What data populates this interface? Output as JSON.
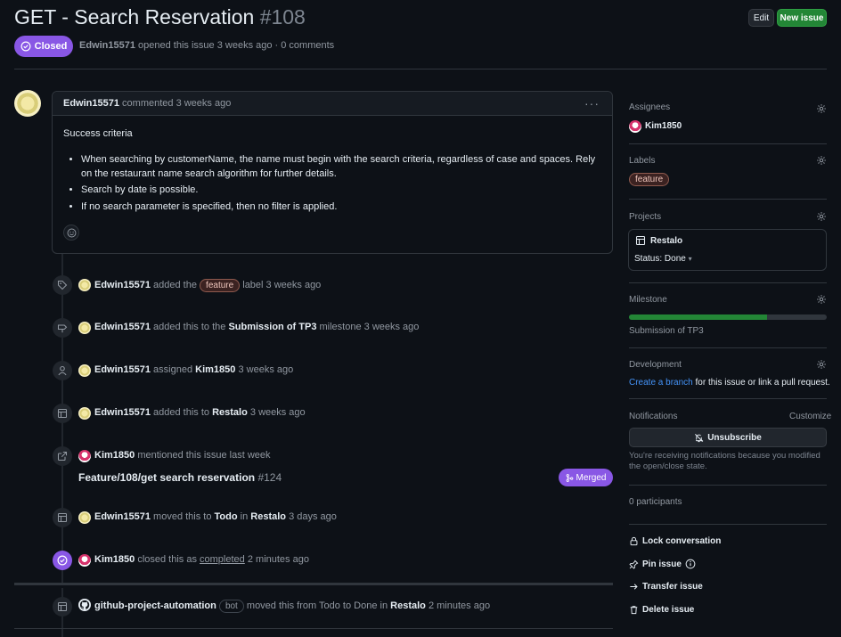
{
  "issue": {
    "title": "GET - Search Reservation",
    "number": "#108",
    "edit_label": "Edit",
    "new_issue_label": "New issue",
    "state": "Closed",
    "author": "Edwin15571",
    "meta_rest": " opened this issue 3 weeks ago · 0 comments"
  },
  "comment": {
    "author": "Edwin15571",
    "action": " commented 3 weeks ago",
    "heading": "Success criteria",
    "bullets": [
      "When searching by customerName, the name must begin with the search criteria, regardless of case and spaces. Rely on the restaurant name search algorithm for further details.",
      "Search by date is possible.",
      "If no search parameter is specified, then no filter is applied."
    ]
  },
  "timeline": {
    "e1": {
      "actor": "Edwin15571",
      "pre": " added the ",
      "label": "feature",
      "post": " label 3 weeks ago"
    },
    "e2": {
      "actor": "Edwin15571",
      "pre": " added this to the ",
      "target": "Submission of TP3",
      "post": " milestone 3 weeks ago"
    },
    "e3": {
      "actor": "Edwin15571",
      "pre": " assigned ",
      "target": "Kim1850",
      "post": " 3 weeks ago"
    },
    "e4": {
      "actor": "Edwin15571",
      "pre": " added this to ",
      "target": "Restalo",
      "post": " 3 weeks ago"
    },
    "e5": {
      "actor": "Kim1850",
      "pre": " mentioned this issue last week",
      "pr_title": "Feature/108/get search reservation",
      "pr_num": " #124",
      "pr_state": "Merged"
    },
    "e6": {
      "actor": "Edwin15571",
      "pre": " moved this to ",
      "target": "Todo",
      "mid": " in ",
      "target2": "Restalo",
      "post": " 3 days ago"
    },
    "e7": {
      "actor": "Kim1850",
      "pre": " closed this as ",
      "link": "completed",
      "post": " 2 minutes ago"
    },
    "e8": {
      "actor": "github-project-automation",
      "bot": "bot",
      "pre": " moved this from ",
      "from": "Todo",
      "mid": " to ",
      "to": "Done",
      "mid2": " in ",
      "target": "Restalo",
      "post": " 2 minutes ago"
    }
  },
  "sidebar": {
    "assignees_heading": "Assignees",
    "assignee": "Kim1850",
    "labels_heading": "Labels",
    "label": "feature",
    "projects_heading": "Projects",
    "project_name": "Restalo",
    "project_status": "Status: Done",
    "milestone_heading": "Milestone",
    "milestone_name": "Submission of TP3",
    "milestone_progress": 0.7,
    "development_heading": "Development",
    "dev_link": "Create a branch",
    "dev_rest": " for this issue or link a pull request.",
    "notifications_heading": "Notifications",
    "customize": "Customize",
    "unsubscribe": "Unsubscribe",
    "notif_note": "You're receiving notifications because you modified the open/close state.",
    "participants": "0 participants",
    "lock": "Lock conversation",
    "pin": "Pin issue",
    "transfer": "Transfer issue",
    "delete": "Delete issue"
  },
  "colors": {
    "closed_badge": "#8957e5",
    "new_issue": "#238636",
    "link": "#4493f8"
  }
}
